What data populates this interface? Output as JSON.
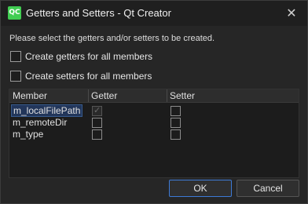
{
  "window": {
    "title": "Getters and Setters - Qt Creator",
    "app_icon_text": "QC",
    "close_glyph": "✕"
  },
  "dialog": {
    "prompt": "Please select the getters and/or setters to be created.",
    "create_getters_label": "Create getters for all members",
    "create_getters_checked": false,
    "create_setters_label": "Create setters for all members",
    "create_setters_checked": false
  },
  "table": {
    "headers": [
      "Member",
      "Getter",
      "Setter"
    ],
    "rows": [
      {
        "member": "m_localFilePath",
        "getter": "checked-disabled",
        "setter": false,
        "selected": true
      },
      {
        "member": "m_remoteDir",
        "getter": false,
        "setter": false,
        "selected": false
      },
      {
        "member": "m_type",
        "getter": false,
        "setter": false,
        "selected": false
      }
    ]
  },
  "buttons": {
    "ok": "OK",
    "cancel": "Cancel"
  },
  "colors": {
    "accent": "#3d7ad6",
    "qt_green": "#41cd52",
    "selection": "#22365a"
  }
}
